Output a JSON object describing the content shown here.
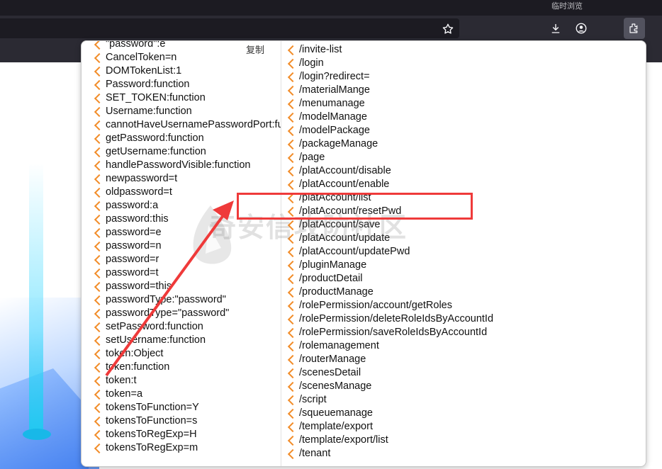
{
  "browser": {
    "profile_label": "临时浏览",
    "bookmark_icon": "star-icon",
    "download_icon": "download-icon",
    "account_icon": "account-icon",
    "extensions_icon": "extensions-icon"
  },
  "popup": {
    "copy_label": "复制",
    "left_items": [
      "\"password\":e",
      "CancelToken=n",
      "DOMTokenList:1",
      "Password:function",
      "SET_TOKEN:function",
      "Username:function",
      "cannotHaveUsernamePasswordPort:function",
      "getPassword:function",
      "getUsername:function",
      "handlePasswordVisible:function",
      "newpassword=t",
      "oldpassword=t",
      "password:a",
      "password:this",
      "password=e",
      "password=n",
      "password=r",
      "password=t",
      "password=this",
      "passwordType:\"password\"",
      "passwordType=\"password\"",
      "setPassword:function",
      "setUsername:function",
      "token:Object",
      "token:function",
      "token:t",
      "token=a",
      "tokensToFunction=Y",
      "tokensToFunction=s",
      "tokensToRegExp=H",
      "tokensToRegExp=m"
    ],
    "right_items": [
      "/invite-list",
      "/login",
      "/login?redirect=",
      "/materialMange",
      "/menumanage",
      "/modelManage",
      "/modelPackage",
      "/packageManage",
      "/page",
      "/platAccount/disable",
      "/platAccount/enable",
      "/platAccount/list",
      "/platAccount/resetPwd",
      "/platAccount/save",
      "/platAccount/update",
      "/platAccount/updatePwd",
      "/pluginManage",
      "/productDetail",
      "/productManage",
      "/rolePermission/account/getRoles",
      "/rolePermission/deleteRoleIdsByAccountId",
      "/rolePermission/saveRoleIdsByAccountId",
      "/rolemanagement",
      "/routerManage",
      "/scenesDetail",
      "/scenesManage",
      "/script",
      "/squeuemanage",
      "/template/export",
      "/template/export/list",
      "/tenant"
    ]
  },
  "watermark_text": "奇安信攻防社区",
  "colors": {
    "chevron": "#f28c28",
    "highlight": "#ef3a3a",
    "chrome_dark": "#2b2a33"
  }
}
